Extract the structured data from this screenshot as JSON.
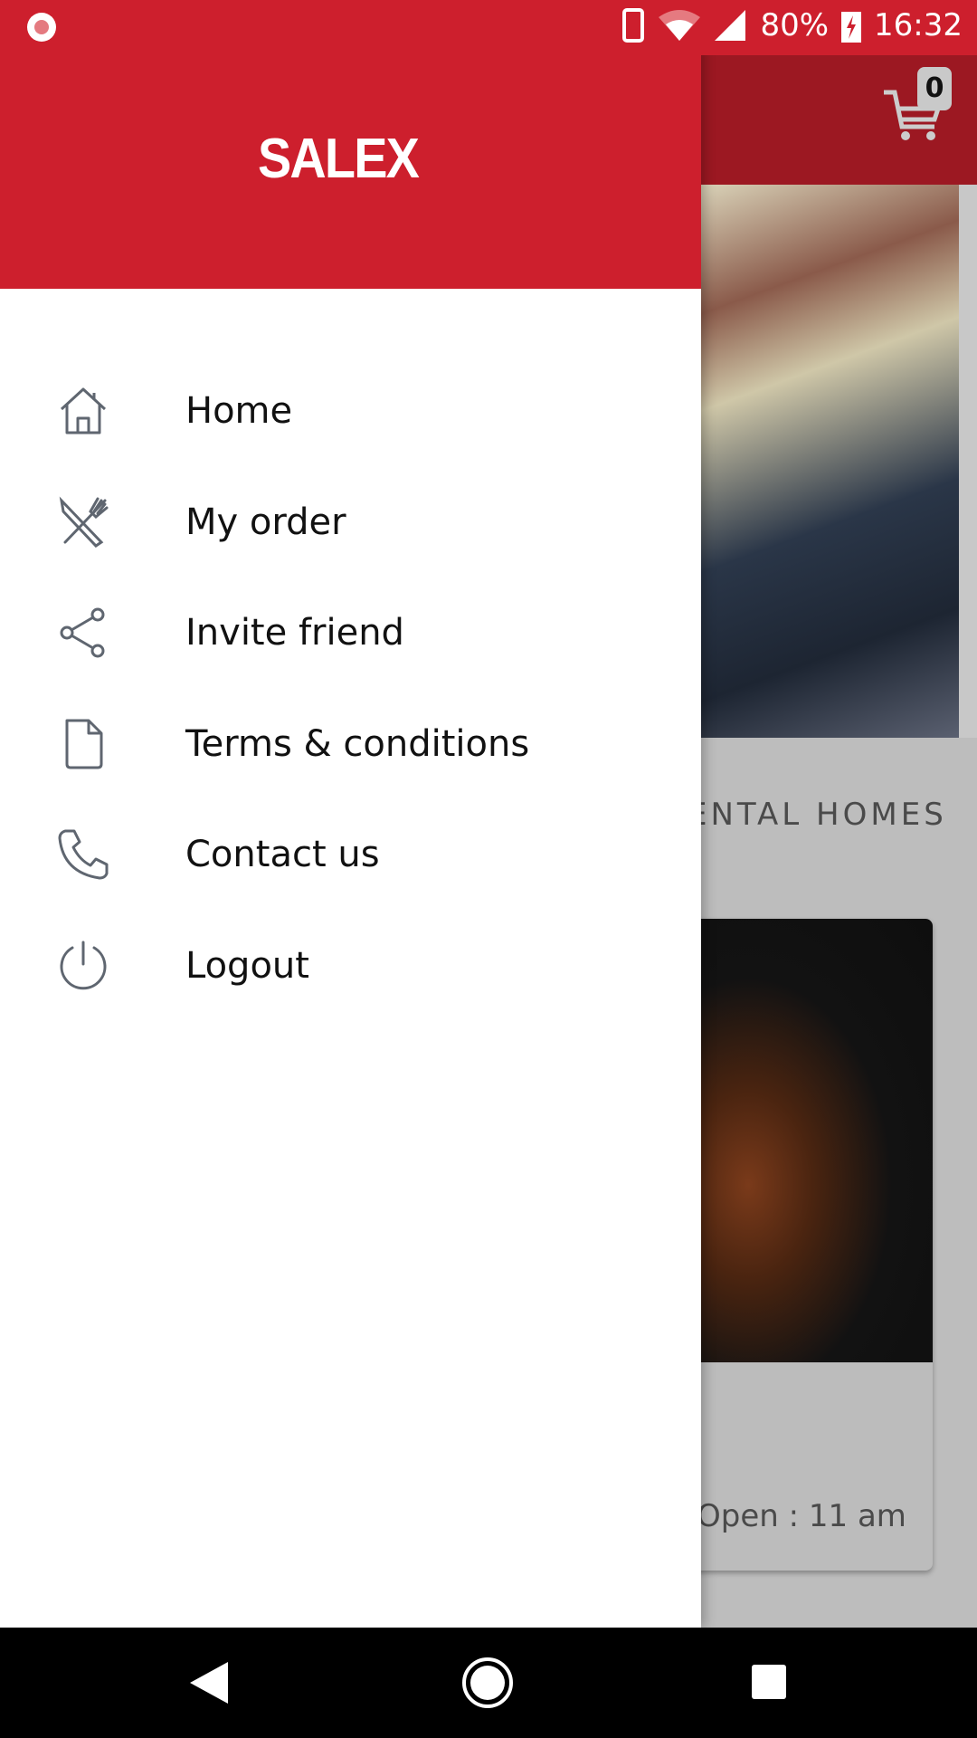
{
  "status_bar": {
    "battery": "80%",
    "time": "16:32",
    "icons": [
      "record-icon",
      "phone-icon",
      "wifi-icon",
      "signal-icon",
      "battery-charging-icon"
    ]
  },
  "drawer": {
    "logo": "SALEX",
    "items": [
      {
        "label": "Home",
        "icon": "home-icon"
      },
      {
        "label": "My order",
        "icon": "fork-knife-icon"
      },
      {
        "label": "Invite friend",
        "icon": "share-icon"
      },
      {
        "label": "Terms & conditions",
        "icon": "document-icon"
      },
      {
        "label": "Contact us",
        "icon": "phone-icon"
      },
      {
        "label": "Logout",
        "icon": "power-icon"
      }
    ]
  },
  "background": {
    "cart_count": "0",
    "section_heading": "ENTAL HOMES",
    "card_open": "Open : 11 am"
  },
  "colors": {
    "brand_red": "#cd1f2d",
    "toolbar_dim": "#9c1822"
  }
}
